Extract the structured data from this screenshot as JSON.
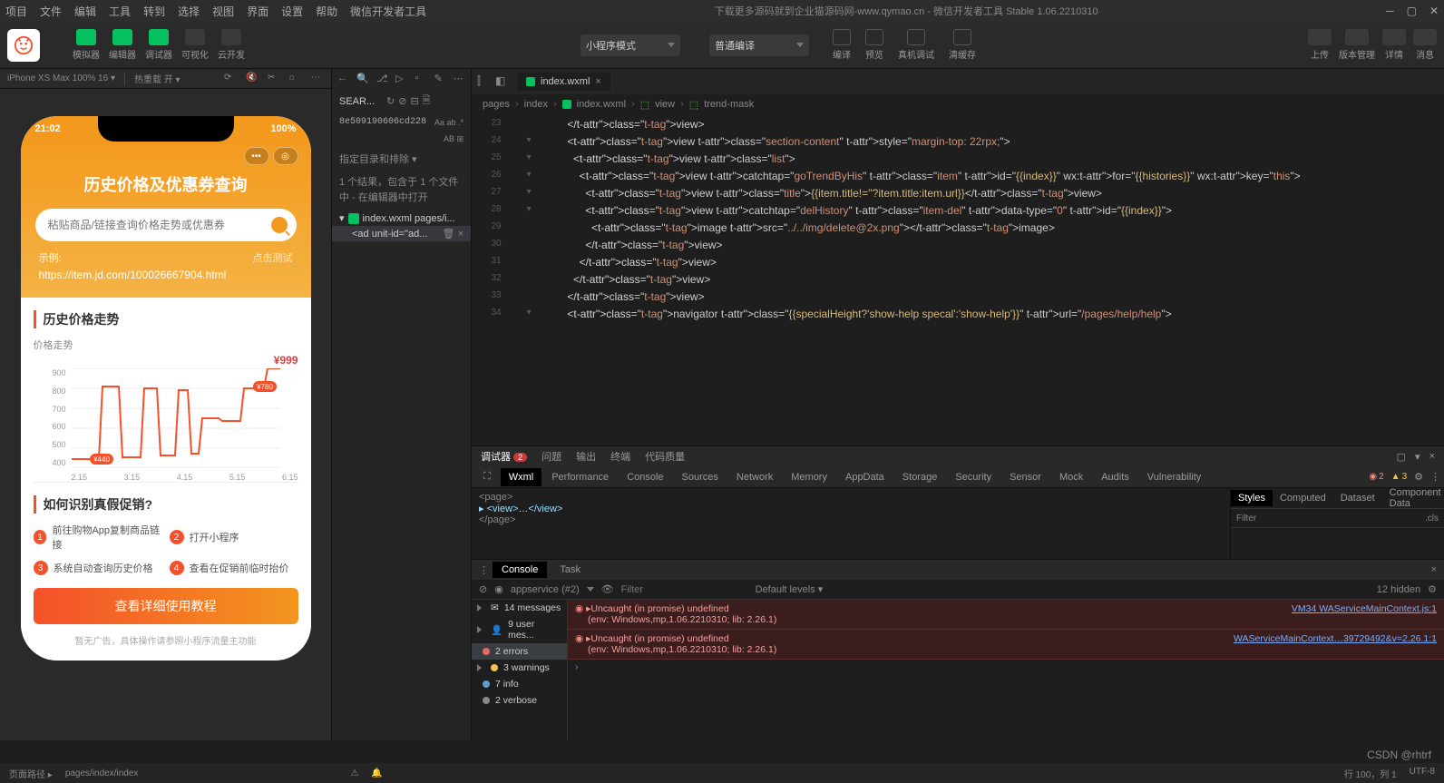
{
  "menu": {
    "items": [
      "项目",
      "文件",
      "编辑",
      "工具",
      "转到",
      "选择",
      "视图",
      "界面",
      "设置",
      "帮助",
      "微信开发者工具"
    ],
    "center": "下载更多源码就到企业猫源码网-www.qymao.cn - 微信开发者工具 Stable 1.06.2210310"
  },
  "toolbar": {
    "left": [
      {
        "label": "模拟器",
        "green": true
      },
      {
        "label": "编辑器",
        "green": true
      },
      {
        "label": "调试器",
        "green": true
      },
      {
        "label": "可视化",
        "green": false
      },
      {
        "label": "云开发",
        "green": false
      }
    ],
    "select1": "小程序模式",
    "select2": "普通编译",
    "mid": [
      {
        "label": "编译"
      },
      {
        "label": "预览"
      },
      {
        "label": "真机调试"
      },
      {
        "label": "清缓存"
      }
    ],
    "right": [
      {
        "label": "上传"
      },
      {
        "label": "版本管理"
      },
      {
        "label": "详情"
      },
      {
        "label": "消息"
      }
    ]
  },
  "deviceBar": {
    "device": "iPhone XS Max 100% 16 ▾",
    "ratio": "热重载 开 ▾"
  },
  "app": {
    "status_time": "21:02",
    "status_right": "100%",
    "title": "历史价格及优惠券查询",
    "search_placeholder": "粘贴商品/链接查询价格走势或优惠券",
    "example_label": "示例:",
    "example_action": "点击测试",
    "example_url": "https://item.jd.com/100026667904.html",
    "chart_title": "历史价格走势",
    "chart_sub": "价格走势",
    "chart_price": "¥999",
    "steps_title": "如何识别真假促销?",
    "steps": [
      "前往购物App复制商品链接",
      "打开小程序",
      "系统自动查询历史价格",
      "查看在促销前临时抬价"
    ],
    "big_btn": "查看详细使用教程",
    "sub_note": "暂无广告，具体操作请参照小程序流量主功能"
  },
  "search": {
    "label": "SEAR...",
    "hash": "8e509190606cd228",
    "toggle": "指定目录和排除 ▾",
    "result_text": "1 个结果，包含于 1 个文件中 - 在编辑器中打开",
    "file": "index.wxml pages/i...",
    "match": "<ad unit-id=\"ad..."
  },
  "editor": {
    "tab": "index.wxml",
    "crumbs": [
      "pages",
      "index",
      "index.wxml",
      "view",
      "trend-mask"
    ]
  },
  "code": [
    {
      "i": 23,
      "t": "          </view>"
    },
    {
      "i": 24,
      "t": "          <view class=\"section-content\" style=\"margin-top: 22rpx;\">"
    },
    {
      "i": 25,
      "t": "            <view class=\"list\">"
    },
    {
      "i": 26,
      "t": "              <view catchtap=\"goTrendByHis\" class=\"item\" id=\"{{index}}\" wx:for=\"{{histories}}\" wx:key=\"this\">"
    },
    {
      "i": 27,
      "t": "                <view class=\"title\">{{item.title!=''?item.title:item.url}}</view>"
    },
    {
      "i": 28,
      "t": "                <view catchtap=\"delHistory\" class=\"item-del\" data-type=\"0\" id=\"{{index}}\">"
    },
    {
      "i": 29,
      "t": "                  <image src=\"../../img/delete@2x.png\"></image>"
    },
    {
      "i": 30,
      "t": "                </view>"
    },
    {
      "i": 31,
      "t": "              </view>"
    },
    {
      "i": 32,
      "t": "            </view>"
    },
    {
      "i": 33,
      "t": "          </view>"
    },
    {
      "i": 34,
      "t": "          <navigator class=\"{{specialHeight?'show-help specal':'show-help'}}\" url=\"/pages/help/help\">"
    }
  ],
  "devtools": {
    "top": [
      "调试器",
      "问题",
      "输出",
      "终端",
      "代码质量"
    ],
    "tabs": [
      "Wxml",
      "Performance",
      "Console",
      "Sources",
      "Network",
      "Memory",
      "AppData",
      "Storage",
      "Security",
      "Sensor",
      "Mock",
      "Audits",
      "Vulnerability"
    ],
    "err_count": "2",
    "warn_count": "3",
    "wxml": [
      "<page>",
      "▸ <view>…</view>",
      "</page>"
    ],
    "styles_tabs": [
      "Styles",
      "Computed",
      "Dataset",
      "Component Data"
    ],
    "filter": "Filter",
    "cls": ".cls"
  },
  "console": {
    "tabs": [
      "Console",
      "Task"
    ],
    "scope": "appservice (#2)",
    "filter": "Filter",
    "levels": "Default levels ▾",
    "hidden": "12 hidden",
    "side": [
      {
        "icon": "msg",
        "text": "14 messages"
      },
      {
        "icon": "user",
        "text": "9 user mes..."
      },
      {
        "icon": "err",
        "text": "2 errors"
      },
      {
        "icon": "warn",
        "text": "3 warnings"
      },
      {
        "icon": "info",
        "text": "7 info"
      },
      {
        "icon": "mute",
        "text": "2 verbose"
      }
    ],
    "errors": [
      {
        "msg": "▸Uncaught (in promise) undefined",
        "env": "(env: Windows,mp,1.06.2210310; lib: 2.26.1)",
        "link": "VM34 WAServiceMainContext.js:1"
      },
      {
        "msg": "▸Uncaught (in promise) undefined",
        "env": "(env: Windows,mp,1.06.2210310; lib: 2.26.1)",
        "link": "WAServiceMainContext…39729492&v=2.26.1:1"
      }
    ]
  },
  "status": {
    "left1": "页面路径 ▸",
    "left2": "pages/index/index",
    "right": [
      "行 100，列 1",
      "UTF-8"
    ]
  },
  "watermark": "CSDN @rhtrf",
  "chart_data": {
    "type": "line",
    "title": "历史价格走势",
    "ylabel": "价格走势",
    "ylim": [
      400,
      900
    ],
    "yticks": [
      900,
      800,
      700,
      600,
      500,
      400
    ],
    "categories": [
      "2.15",
      "3.15",
      "4.15",
      "5.15",
      "6.15"
    ],
    "values": [
      440,
      440,
      780,
      450,
      780,
      470,
      770,
      480,
      650,
      640,
      780,
      780,
      999
    ],
    "current_price": 999,
    "low_label": "¥440",
    "high_label": "¥780"
  }
}
